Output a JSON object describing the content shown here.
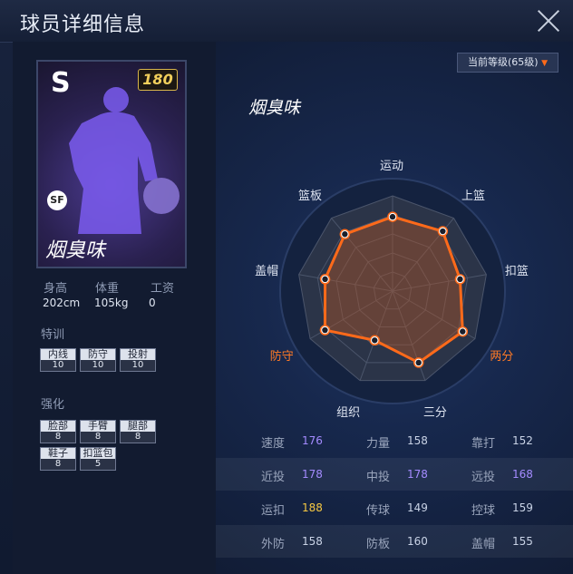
{
  "window": {
    "title": "球员详细信息"
  },
  "card": {
    "grade": "S",
    "overall": "180",
    "position": "SF",
    "name": "烟臭味"
  },
  "bio": {
    "height_label": "身高",
    "height_value": "202cm",
    "weight_label": "体重",
    "weight_value": "105kg",
    "salary_label": "工资",
    "salary_value": "0"
  },
  "training": {
    "title": "特训",
    "items": [
      {
        "label": "内线",
        "value": "10"
      },
      {
        "label": "防守",
        "value": "10"
      },
      {
        "label": "投射",
        "value": "10"
      }
    ]
  },
  "enhance": {
    "title": "强化",
    "items": [
      {
        "label": "脸部",
        "value": "8"
      },
      {
        "label": "手臂",
        "value": "8"
      },
      {
        "label": "腿部",
        "value": "8"
      },
      {
        "label": "鞋子",
        "value": "8"
      },
      {
        "label": "扣篮包",
        "value": "5"
      }
    ]
  },
  "level_selector": {
    "label": "当前等级(65级)"
  },
  "player_name": "烟臭味",
  "radar": {
    "axes": [
      "运动",
      "上篮",
      "扣篮",
      "两分",
      "三分",
      "组织",
      "防守",
      "盖帽",
      "篮板"
    ],
    "highlighted": [
      "两分",
      "防守"
    ],
    "values": [
      0.78,
      0.82,
      0.72,
      0.85,
      0.8,
      0.55,
      0.82,
      0.72,
      0.78
    ],
    "accent": "#ff6a1a"
  },
  "stats": [
    [
      {
        "label": "速度",
        "value": "176",
        "color": "purple"
      },
      {
        "label": "力量",
        "value": "158",
        "color": "normal"
      },
      {
        "label": "靠打",
        "value": "152",
        "color": "normal"
      }
    ],
    [
      {
        "label": "近投",
        "value": "178",
        "color": "purple"
      },
      {
        "label": "中投",
        "value": "178",
        "color": "purple"
      },
      {
        "label": "远投",
        "value": "168",
        "color": "purple"
      }
    ],
    [
      {
        "label": "运扣",
        "value": "188",
        "color": "gold"
      },
      {
        "label": "传球",
        "value": "149",
        "color": "normal"
      },
      {
        "label": "控球",
        "value": "159",
        "color": "normal"
      }
    ],
    [
      {
        "label": "外防",
        "value": "158",
        "color": "normal"
      },
      {
        "label": "防板",
        "value": "160",
        "color": "normal"
      },
      {
        "label": "盖帽",
        "value": "155",
        "color": "normal"
      }
    ]
  ]
}
